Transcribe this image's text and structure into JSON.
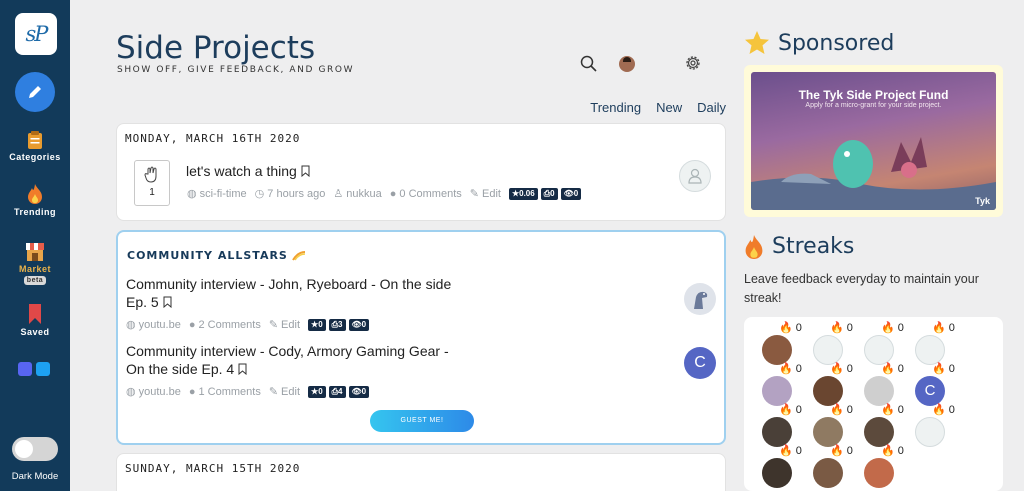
{
  "sidebar": {
    "logo": "sP",
    "items": [
      {
        "label": "Categories",
        "icon": "clipboard-icon"
      },
      {
        "label": "Trending",
        "icon": "fire-icon"
      },
      {
        "label": "Market",
        "badge": "beta",
        "icon": "store-icon"
      },
      {
        "label": "Saved",
        "icon": "bookmark-icon"
      }
    ],
    "dark_mode_label": "Dark Mode"
  },
  "header": {
    "title": "Side Projects",
    "subtitle": "SHOW OFF, GIVE FEEDBACK, AND GROW"
  },
  "tabs": [
    "Trending",
    "New",
    "Daily"
  ],
  "feed": {
    "day1": {
      "date": "MONDAY, MARCH 16TH 2020",
      "post": {
        "title": "let's watch a thing",
        "votes": "1",
        "category": "sci-fi-time",
        "time": "7 hours ago",
        "author": "nukkua",
        "comments": "0 Comments",
        "edit": "Edit",
        "stats": [
          "★0.06",
          "⎙0",
          "👁0"
        ]
      }
    },
    "allstars": {
      "label": "COMMUNITY ALLSTARS",
      "posts": [
        {
          "title_line1": "Community interview - John, Ryeboard - On the side",
          "title_line2": "Ep. 5",
          "source": "youtu.be",
          "comments": "2 Comments",
          "edit": "Edit",
          "stats": [
            "★0",
            "⎙3",
            "👁0"
          ]
        },
        {
          "title_line1": "Community interview - Cody, Armory Gaming Gear -",
          "title_line2": "On the side Ep. 4",
          "source": "youtu.be",
          "comments": "1 Comments",
          "edit": "Edit",
          "stats": [
            "★0",
            "⎙4",
            "👁0"
          ],
          "avatar_letter": "C"
        }
      ],
      "guest_button": "GUEST ME!"
    },
    "day2": {
      "date": "SUNDAY, MARCH 15TH 2020"
    }
  },
  "sponsored": {
    "title": "Sponsored",
    "ad_title": "The Tyk Side Project Fund",
    "ad_subtitle": "Apply for a micro-grant for your side project.",
    "ad_brand": "Tyk"
  },
  "streaks": {
    "title": "Streaks",
    "text": "Leave feedback everyday to maintain your streak!",
    "rows": [
      [
        "0",
        "0",
        "0",
        "0"
      ],
      [
        "0",
        "0",
        "0",
        "0"
      ],
      [
        "0",
        "0",
        "0",
        "0"
      ],
      [
        "0",
        "0",
        "0"
      ]
    ],
    "letter_avatar": "C"
  },
  "colors": {
    "sidebar": "#123a5a",
    "accent": "#2f7fe0",
    "title": "#1d3d5c",
    "stat_badge": "#152b45",
    "avatar_letter_bg": "#5566c4"
  }
}
